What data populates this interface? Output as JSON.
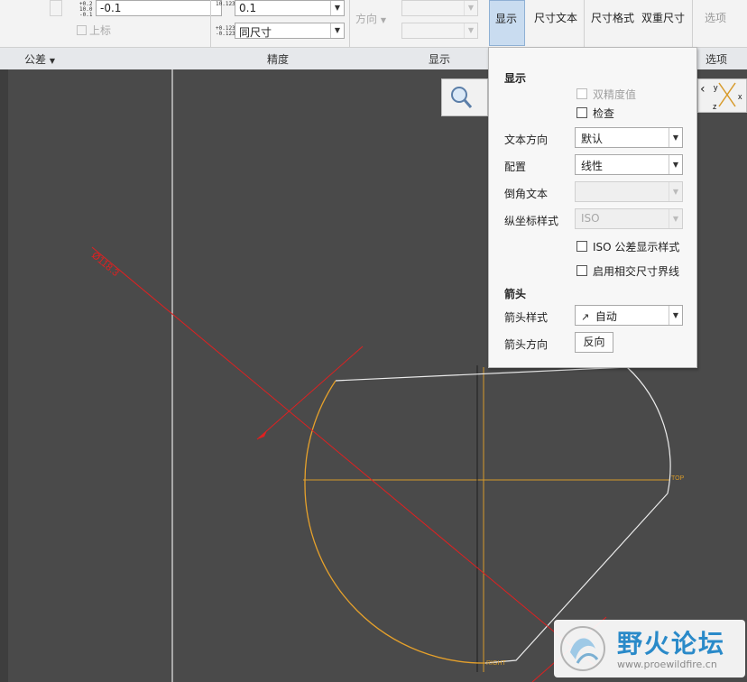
{
  "ribbon": {
    "tolerance_value": "-0.1",
    "upper_label": "上标",
    "precision_value": "0.1",
    "precision_mode": "同尺寸",
    "direction_label": "方向",
    "display_button": "显示",
    "dim_text_button": "尺寸文本",
    "dim_format_button": "尺寸格式",
    "dual_dim_button": "双重尺寸",
    "options_button": "选项",
    "groups": {
      "tolerance": "公差",
      "precision": "精度",
      "display": "显示",
      "options": "选项"
    },
    "tiny_icons": {
      "tol_top": "+0.2",
      "tol_mid": "10.0",
      "tol_bot": "-0.1",
      "prec_top": "10.123",
      "prec_b1": "+0.123",
      "prec_b2": "-0.123"
    }
  },
  "panel": {
    "title": "显示",
    "dual_precision": "双精度值",
    "inspect": "检查",
    "text_orientation_label": "文本方向",
    "text_orientation_value": "默认",
    "config_label": "配置",
    "config_value": "线性",
    "chamfer_text_label": "倒角文本",
    "chamfer_text_value": "",
    "ordinate_style_label": "纵坐标样式",
    "ordinate_style_value": "ISO",
    "iso_tol_display": "ISO 公差显示样式",
    "enable_intersect": "启用相交尺寸界线",
    "arrow_header": "箭头",
    "arrow_style_label": "箭头样式",
    "arrow_style_value": "自动",
    "arrow_dir_label": "箭头方向",
    "arrow_dir_button": "反向"
  },
  "canvas": {
    "dimension_text": "Ø118.3",
    "datum_top": "TOP",
    "datum_right": "RIGHT",
    "csys_x": "x",
    "csys_y": "y",
    "csys_z": "z"
  },
  "watermark": {
    "title": "野火论坛",
    "url": "www.proewildfire.cn"
  },
  "colors": {
    "background": "#4a4a4a",
    "dimension": "#e02020",
    "datum": "#d79a2a",
    "sketch": "#e8e8e8"
  }
}
